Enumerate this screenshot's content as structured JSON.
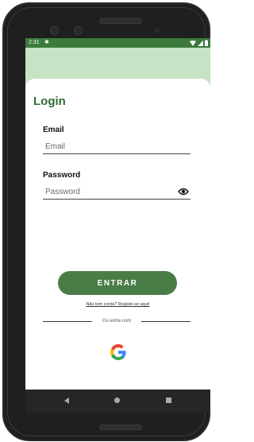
{
  "status_bar": {
    "time": "2:31",
    "settings_icon": "gear-icon",
    "icons": [
      "wifi-icon",
      "signal-icon",
      "battery-icon"
    ]
  },
  "login": {
    "title": "Login",
    "email_label": "Email",
    "email_placeholder": "Email",
    "email_value": "",
    "password_label": "Password",
    "password_placeholder": "Password",
    "password_value": "",
    "toggle_icon": "eye-icon",
    "enter_label": "ENTRAR",
    "signup_link": "Não tem conta? Registe-se aqui!",
    "divider_text": "Ou entre com",
    "google_icon": "google-icon"
  },
  "nav_bar": {
    "icons": [
      "back-icon",
      "home-icon",
      "recents-icon"
    ]
  },
  "colors": {
    "primary": "#4a7c47",
    "title": "#2f6b35",
    "status_bar": "#3b7a3b",
    "header_bg": "#c6e3c6"
  }
}
